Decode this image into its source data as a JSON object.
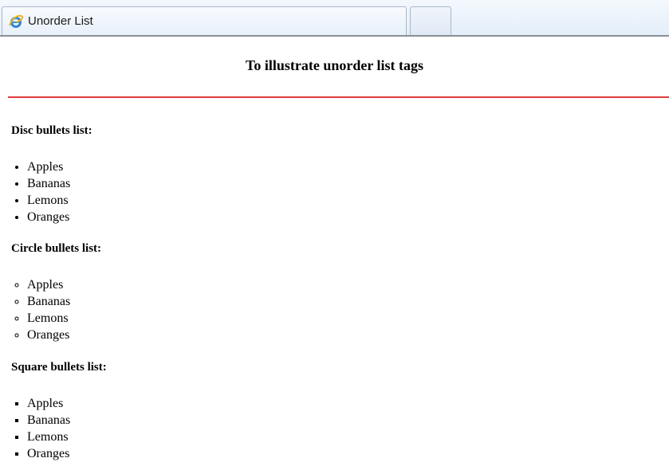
{
  "browser": {
    "tab_title": "Unorder List",
    "icon": "internet-explorer-icon"
  },
  "page": {
    "heading": "To illustrate unorder list tags",
    "rule_color": "#e03a3a"
  },
  "lists": {
    "disc": {
      "title": "Disc bullets list:",
      "items": [
        "Apples",
        "Bananas",
        "Lemons",
        "Oranges"
      ]
    },
    "circle": {
      "title": "Circle bullets list:",
      "items": [
        "Apples",
        "Bananas",
        "Lemons",
        "Oranges"
      ]
    },
    "square": {
      "title": "Square bullets list:",
      "items": [
        "Apples",
        "Bananas",
        "Lemons",
        "Oranges"
      ]
    }
  }
}
